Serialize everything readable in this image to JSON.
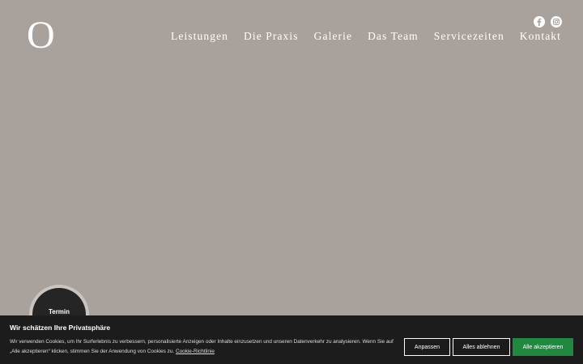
{
  "header": {
    "logo_letter": "O",
    "nav": [
      {
        "label": "Leistungen"
      },
      {
        "label": "Die Praxis"
      },
      {
        "label": "Galerie"
      },
      {
        "label": "Das Team"
      },
      {
        "label": "Servicezeiten"
      },
      {
        "label": "Kontakt"
      }
    ],
    "social": [
      {
        "icon": "facebook-icon"
      },
      {
        "icon": "instagram-icon"
      }
    ]
  },
  "termin": {
    "label": "Termin"
  },
  "cookie_banner": {
    "title": "Wir schätzen Ihre Privatsphäre",
    "text": "Wir verwenden Cookies, um Ihr Surferlebnis zu verbessern, personalisierte Anzeigen oder Inhalte einzusetzen und unseren Datenverkehr zu analysieren. Wenn Sie auf „Alle akzeptieren“ klicken, stimmen Sie der Anwendung von Cookies zu.",
    "link": "Cookie-Richtlinie",
    "buttons": {
      "customize": "Anpassen",
      "reject": "Alles ablehnen",
      "accept": "Alle akzeptieren"
    }
  },
  "colors": {
    "background": "#a8a19c",
    "banner": "#1c1c1c",
    "accept": "#1f8a3f"
  }
}
